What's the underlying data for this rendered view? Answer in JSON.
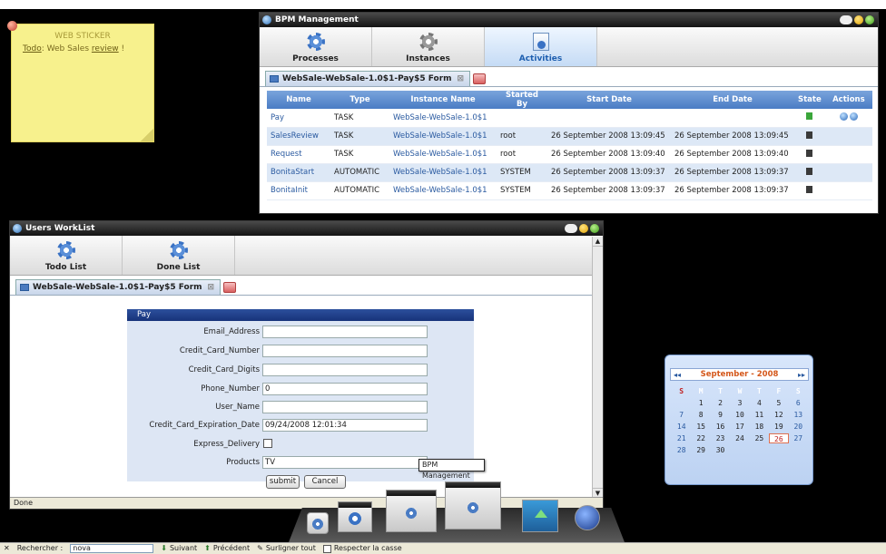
{
  "sticker": {
    "title": "WEB STICKER",
    "todo_label": "Todo",
    "text_pre": ": Web Sales ",
    "link": "review",
    "text_post": " !"
  },
  "bpm": {
    "title": "BPM Management",
    "tabs": [
      {
        "label": "Processes"
      },
      {
        "label": "Instances"
      },
      {
        "label": "Activities"
      }
    ],
    "form_tab": "WebSale-WebSale-1.0$1-Pay$5 Form",
    "columns": [
      "Name",
      "Type",
      "Instance Name",
      "Started By",
      "Start Date",
      "End Date",
      "State",
      "Actions"
    ],
    "rows": [
      {
        "name": "Pay",
        "type": "TASK",
        "instance": "WebSale-WebSale-1.0$1",
        "started_by": "",
        "start": "",
        "end": ""
      },
      {
        "name": "SalesReview",
        "type": "TASK",
        "instance": "WebSale-WebSale-1.0$1",
        "started_by": "root",
        "start": "26 September 2008 13:09:45",
        "end": "26 September 2008 13:09:45"
      },
      {
        "name": "Request",
        "type": "TASK",
        "instance": "WebSale-WebSale-1.0$1",
        "started_by": "root",
        "start": "26 September 2008 13:09:40",
        "end": "26 September 2008 13:09:40"
      },
      {
        "name": "BonitaStart",
        "type": "AUTOMATIC",
        "instance": "WebSale-WebSale-1.0$1",
        "started_by": "SYSTEM",
        "start": "26 September 2008 13:09:37",
        "end": "26 September 2008 13:09:37"
      },
      {
        "name": "BonitaInit",
        "type": "AUTOMATIC",
        "instance": "WebSale-WebSale-1.0$1",
        "started_by": "SYSTEM",
        "start": "26 September 2008 13:09:37",
        "end": "26 September 2008 13:09:37"
      }
    ]
  },
  "worklist": {
    "title": "Users WorkList",
    "tabs": [
      {
        "label": "Todo List"
      },
      {
        "label": "Done List"
      }
    ],
    "form_tab": "WebSale-WebSale-1.0$1-Pay$5 Form",
    "form_header": "Pay",
    "fields": {
      "email": {
        "label": "Email_Address",
        "value": ""
      },
      "cc_number": {
        "label": "Credit_Card_Number",
        "value": ""
      },
      "cc_digits": {
        "label": "Credit_Card_Digits",
        "value": ""
      },
      "phone": {
        "label": "Phone_Number",
        "value": "0"
      },
      "user": {
        "label": "User_Name",
        "value": ""
      },
      "cc_exp": {
        "label": "Credit_Card_Expiration_Date",
        "value": "09/24/2008 12:01:34"
      },
      "express": {
        "label": "Express_Delivery"
      },
      "products": {
        "label": "Products",
        "value": "TV"
      }
    },
    "submit": "submit",
    "cancel": "Cancel",
    "status": "Done"
  },
  "tooltip": "BPM Management",
  "calendar": {
    "month": "September - 2008",
    "days_header": [
      "S",
      "M",
      "T",
      "W",
      "T",
      "F",
      "S"
    ],
    "days": [
      "",
      "1",
      "2",
      "3",
      "4",
      "5",
      "6",
      "7",
      "8",
      "9",
      "10",
      "11",
      "12",
      "13",
      "14",
      "15",
      "16",
      "17",
      "18",
      "19",
      "20",
      "21",
      "22",
      "23",
      "24",
      "25",
      "26",
      "27",
      "28",
      "29",
      "30",
      "",
      "",
      "",
      ""
    ],
    "today": "26"
  },
  "findbar": {
    "close": "✕",
    "label": "Rechercher :",
    "value": "nova",
    "next": "Suivant",
    "prev": "Précédent",
    "highlight": "Surligner tout",
    "match_case": "Respecter la casse"
  }
}
